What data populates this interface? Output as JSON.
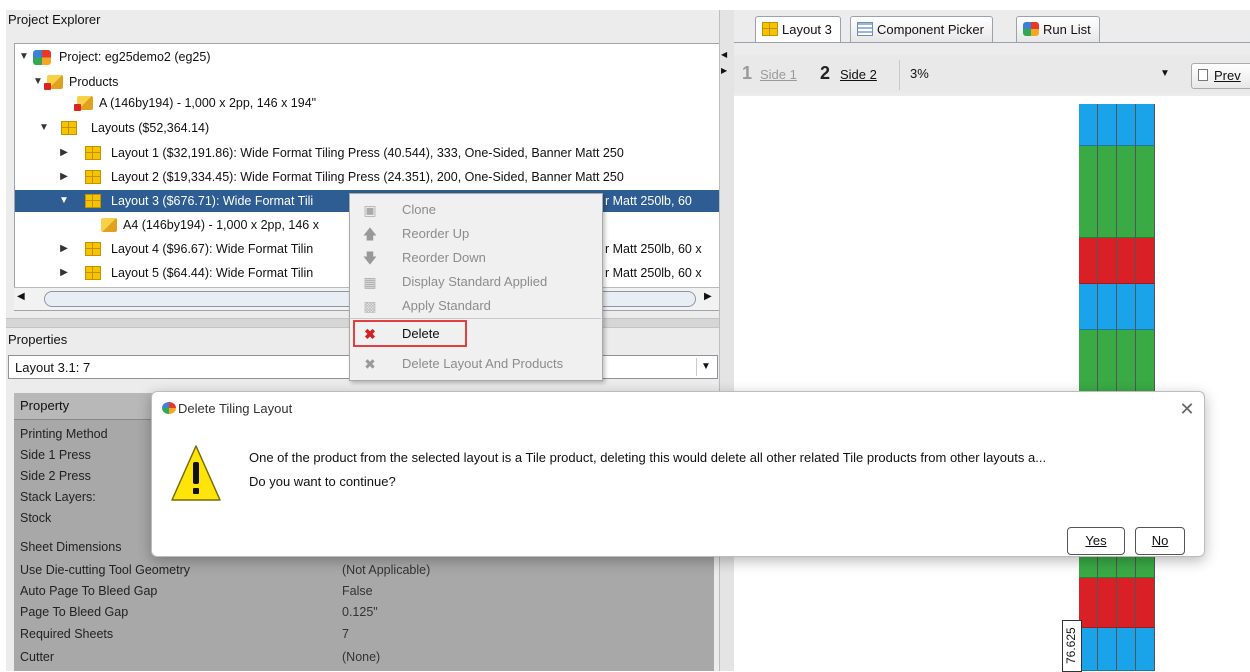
{
  "project_explorer": {
    "title": "Project Explorer",
    "tree": {
      "project": "Project: eg25demo2 (eg25)",
      "products_label": "Products",
      "product_a": "A (146by194) - 1,000 x 2pp, 146 x 194\"",
      "layouts_label": "Layouts ($52,364.14)",
      "layout1": "Layout 1 ($32,191.86): Wide Format Tiling Press (40.544), 333, One-Sided, Banner Matt 250",
      "layout2": "Layout 2 ($19,334.45): Wide Format Tiling Press (24.351), 200, One-Sided, Banner Matt 250",
      "layout3_left": "Layout 3 ($676.71): Wide Format Tili",
      "layout3_right": "r Matt 250lb, 60",
      "a4": "A4 (146by194) - 1,000 x 2pp, 146 x",
      "layout4_left": "Layout 4 ($96.67): Wide Format Tilin",
      "layout4_right": "r Matt 250lb, 60 x",
      "layout5_left": "Layout 5 ($64.44): Wide Format Tilin",
      "layout5_right": "r Matt 250lb, 60 x"
    }
  },
  "properties": {
    "title": "Properties",
    "selected": "Layout 3.1: 7",
    "header": "Property",
    "rows": [
      {
        "label": "Printing Method",
        "value": ""
      },
      {
        "label": "Side 1 Press",
        "value": ""
      },
      {
        "label": "Side 2 Press",
        "value": ""
      },
      {
        "label": "Stack Layers:",
        "value": ""
      },
      {
        "label": "Stock",
        "value": ""
      },
      {
        "label": "Sheet Dimensions",
        "value": ""
      },
      {
        "label": "Use Die-cutting Tool Geometry",
        "value": "(Not Applicable)"
      },
      {
        "label": "Auto Page To Bleed Gap",
        "value": "False"
      },
      {
        "label": "Page To Bleed Gap",
        "value": "0.125\""
      },
      {
        "label": "Required Sheets",
        "value": "7"
      },
      {
        "label": "Cutter",
        "value": "(None)"
      }
    ]
  },
  "tabs": [
    {
      "label": "Layout 3"
    },
    {
      "label": "Component Picker"
    },
    {
      "label": "Run List"
    }
  ],
  "toolbar": {
    "side1_num": "1",
    "side1_label": "Side 1",
    "side2_num": "2",
    "side2_label": "Side 2",
    "zoom": "3%",
    "preview": "Prev"
  },
  "canvas": {
    "dimension_label": "76.625",
    "colors": {
      "blue": "#1aa3e8",
      "green": "#3aaa45",
      "red": "#d92027"
    }
  },
  "context_menu": {
    "clone": "Clone",
    "reorder_up": "Reorder Up",
    "reorder_down": "Reorder Down",
    "display_standard": "Display Standard Applied",
    "apply_standard": "Apply Standard",
    "delete": "Delete",
    "delete_layout_products": "Delete Layout And Products"
  },
  "dialog": {
    "title": "Delete Tiling Layout",
    "message1": "One of the product from the selected layout is a Tile product, deleting this would delete all other related Tile products from other layouts a...",
    "message2": "Do you want to continue?",
    "yes": "Yes",
    "no": "No"
  }
}
